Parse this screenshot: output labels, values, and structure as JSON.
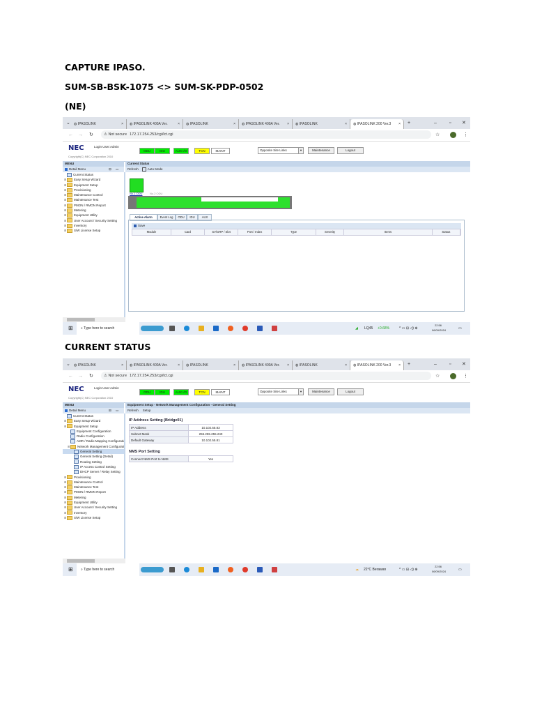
{
  "headings": {
    "title": "CAPTURE IPASO.",
    "link": "SUM-SB-BSK-1075 <> SUM-SK-PDP-0502",
    "ne": "(NE)",
    "current_status": "CURRENT STATUS"
  },
  "browser": {
    "tabs": [
      "IPASOLINK",
      "IPASOLINK 400A Ver.",
      "IPASOLINK",
      "IPASOLINK 400A Ver.",
      "IPASOLINK",
      "IPASOLINK 200 Ver.3"
    ],
    "tab_close": "×",
    "new_tab": "+",
    "min": "–",
    "max": "▫",
    "close": "✕",
    "not_secure": "⚠ Not secure",
    "url": "172.17.254.253/cgi/lct.cgi"
  },
  "app": {
    "logo": "NEC",
    "login": "Login User:Admin",
    "copyright": "Copyright(C) NEC Corporation 2010",
    "status": [
      {
        "label": "ODU",
        "color": "#00ee00"
      },
      {
        "label": "IDU",
        "color": "#00ee00"
      },
      {
        "label": "AUX I/O",
        "color": "#00ee00"
      },
      {
        "label": "TCN",
        "color": "#ffff00"
      },
      {
        "label": "MAINT",
        "color": "#ffffff"
      }
    ],
    "opposite": "Opposite Site Links",
    "maintenance": "Maintenance",
    "logout": "Logout",
    "menu_title": "MENU",
    "detail_menu": "Detail Menu",
    "refresh": "Refresh",
    "auto_mode": "Auto Mode",
    "setup": "Setup"
  },
  "screens": [
    {
      "content_title": "Current Status",
      "menu": [
        {
          "label": "Current Status",
          "type": "page",
          "level": 0
        },
        {
          "label": "Easy Setup Wizard",
          "type": "folder",
          "level": 0
        },
        {
          "label": "Equipment Setup",
          "type": "folder",
          "level": 0
        },
        {
          "label": "Provisioning",
          "type": "folder",
          "level": 0
        },
        {
          "label": "Maintenance Control",
          "type": "folder",
          "level": 0
        },
        {
          "label": "Maintenance Test",
          "type": "folder",
          "level": 0
        },
        {
          "label": "PMON / RMON Report",
          "type": "folder",
          "level": 0
        },
        {
          "label": "Metering",
          "type": "folder",
          "level": 0
        },
        {
          "label": "Equipment Utility",
          "type": "folder",
          "level": 0
        },
        {
          "label": "User Account / Security Setting",
          "type": "folder",
          "level": 0
        },
        {
          "label": "Inventory",
          "type": "folder",
          "level": 0
        },
        {
          "label": "S/W License Setup",
          "type": "folder",
          "level": 0
        }
      ],
      "odu_labels": [
        "No.1 ODU",
        "No.2 ODU"
      ],
      "alarm_tabs": [
        "Active Alarm",
        "Event Log",
        "ODU",
        "IDU",
        "AUX"
      ],
      "save": "Save",
      "columns": [
        "Module",
        "Card",
        "SV/GRP / Slot",
        "Port / Index",
        "Type",
        "Severity",
        "Items",
        "Status"
      ],
      "tray": {
        "ticker": "LQ45",
        "change": "+0.68%",
        "time": "22:56",
        "date": "06/09/2024"
      }
    },
    {
      "content_title": "Equipment Setup - Network Management Configuration - General Setting",
      "menu": [
        {
          "label": "Current Status",
          "type": "page",
          "level": 0
        },
        {
          "label": "Easy Setup Wizard",
          "type": "folder",
          "level": 0
        },
        {
          "label": "Equipment Setup",
          "type": "folder",
          "level": 0
        },
        {
          "label": "Equipment Configuration",
          "type": "page",
          "level": 1
        },
        {
          "label": "Radio Configuration",
          "type": "page",
          "level": 1
        },
        {
          "label": "AMR / Radio Mapping Configuration",
          "type": "page",
          "level": 1
        },
        {
          "label": "Network Management Configuration",
          "type": "folder",
          "level": 1
        },
        {
          "label": "General Setting",
          "type": "page",
          "level": 2,
          "selected": true
        },
        {
          "label": "General Setting (Detail)",
          "type": "page",
          "level": 2
        },
        {
          "label": "Routing Setting",
          "type": "page",
          "level": 2
        },
        {
          "label": "IP Access Control Setting",
          "type": "page",
          "level": 2
        },
        {
          "label": "DHCP Server / Relay Setting",
          "type": "page",
          "level": 2
        },
        {
          "label": "Provisioning",
          "type": "folder",
          "level": 0
        },
        {
          "label": "Maintenance Control",
          "type": "folder",
          "level": 0
        },
        {
          "label": "Maintenance Test",
          "type": "folder",
          "level": 0
        },
        {
          "label": "PMON / RMON Report",
          "type": "folder",
          "level": 0
        },
        {
          "label": "Metering",
          "type": "folder",
          "level": 0
        },
        {
          "label": "Equipment Utility",
          "type": "folder",
          "level": 0
        },
        {
          "label": "User Account / Security Setting",
          "type": "folder",
          "level": 0
        },
        {
          "label": "Inventory",
          "type": "folder",
          "level": 0
        },
        {
          "label": "S/W License Setup",
          "type": "folder",
          "level": 0
        }
      ],
      "ip_title": "IP Address Setting (Bridge01)",
      "ip_rows": [
        [
          "IP Address",
          "10.102.55.83"
        ],
        [
          "Subnet Mask",
          "255.255.255.240"
        ],
        [
          "Default Gateway",
          "10.102.55.81"
        ]
      ],
      "nms_title": "NMS Port Setting",
      "nms_rows": [
        [
          "Connect NMS Port to NMS",
          "Yes"
        ]
      ],
      "tray": {
        "weather": "22°C Berawan",
        "time": "22:56",
        "date": "06/09/2024"
      }
    }
  ],
  "taskbar": {
    "search": "Type here to search"
  }
}
